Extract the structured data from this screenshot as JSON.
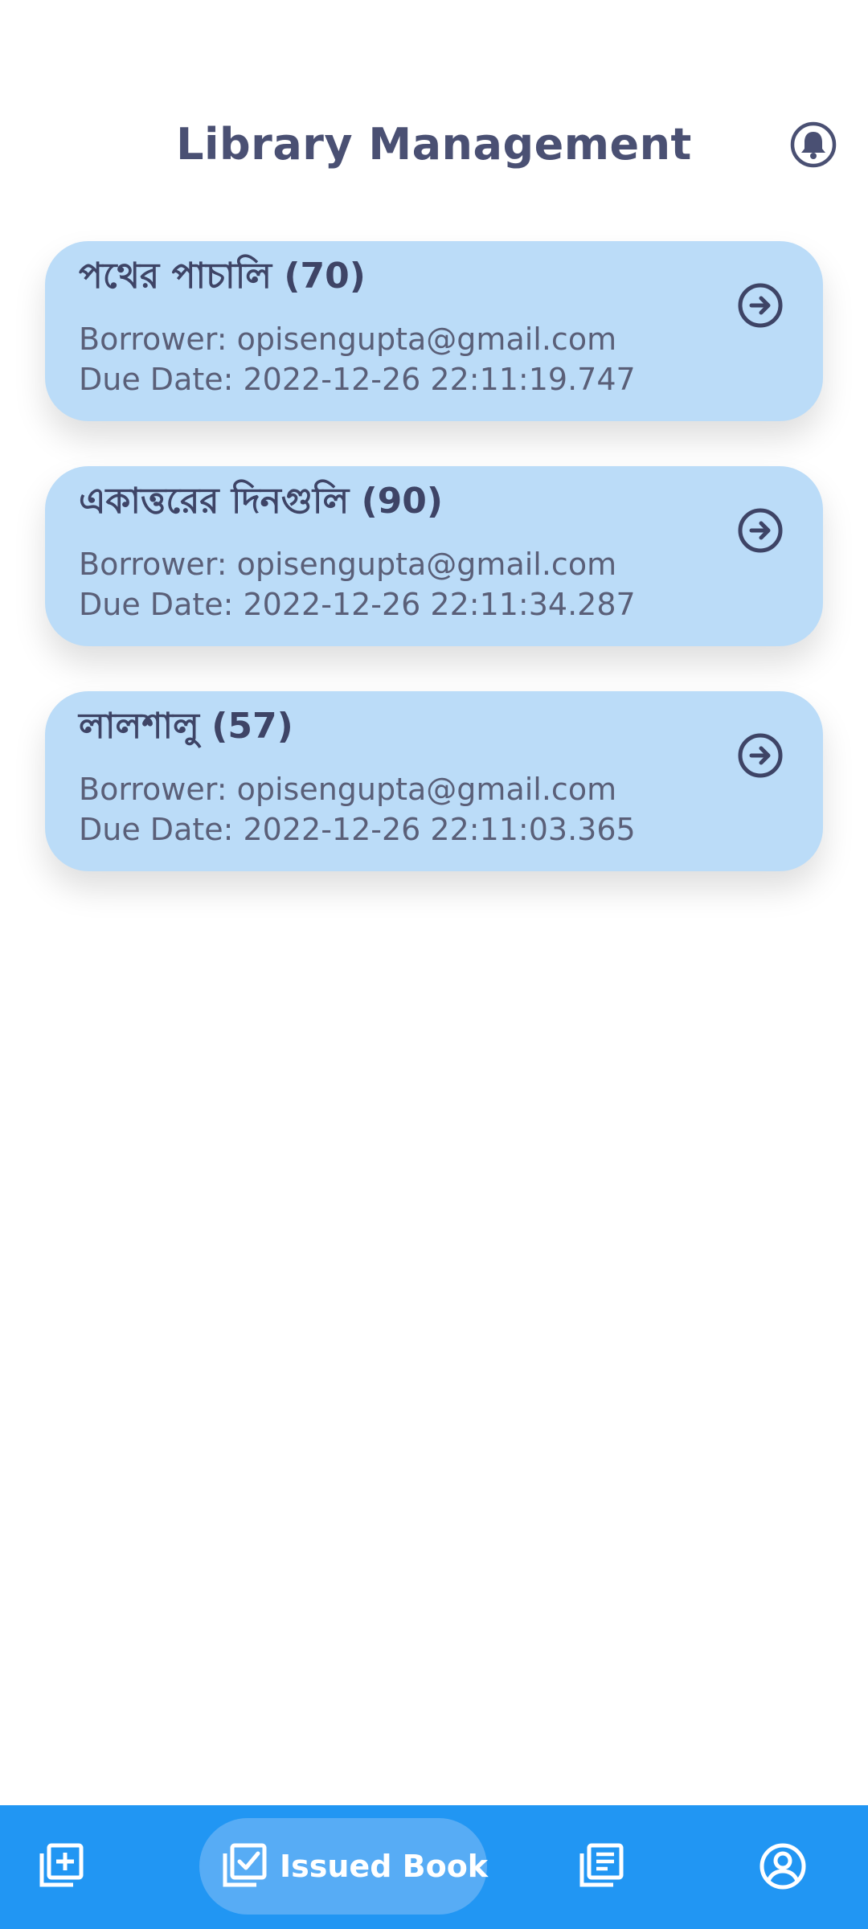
{
  "header": {
    "title": "Library Management",
    "bell_icon": "bell-icon"
  },
  "books": [
    {
      "title": "পথের পাচালি (70)",
      "borrower": "Borrower: opisengupta@gmail.com",
      "due_date": "Due Date: 2022-12-26 22:11:19.747"
    },
    {
      "title": "একাত্তরের দিনগুলি (90)",
      "borrower": "Borrower: opisengupta@gmail.com",
      "due_date": "Due Date: 2022-12-26 22:11:34.287"
    },
    {
      "title": "লালশালু (57)",
      "borrower": "Borrower: opisengupta@gmail.com",
      "due_date": "Due Date: 2022-12-26 22:11:03.365"
    }
  ],
  "bottom_nav": {
    "active_label": "Issued Book",
    "items": [
      "add-book-icon",
      "issued-book-icon",
      "book-list-icon",
      "profile-icon"
    ]
  },
  "colors": {
    "accent": "#2196f3",
    "active_pill": "#57acf5",
    "card_bg": "#bbdcf8",
    "title_text": "#4a5073",
    "icon_dark": "#3e4466"
  }
}
